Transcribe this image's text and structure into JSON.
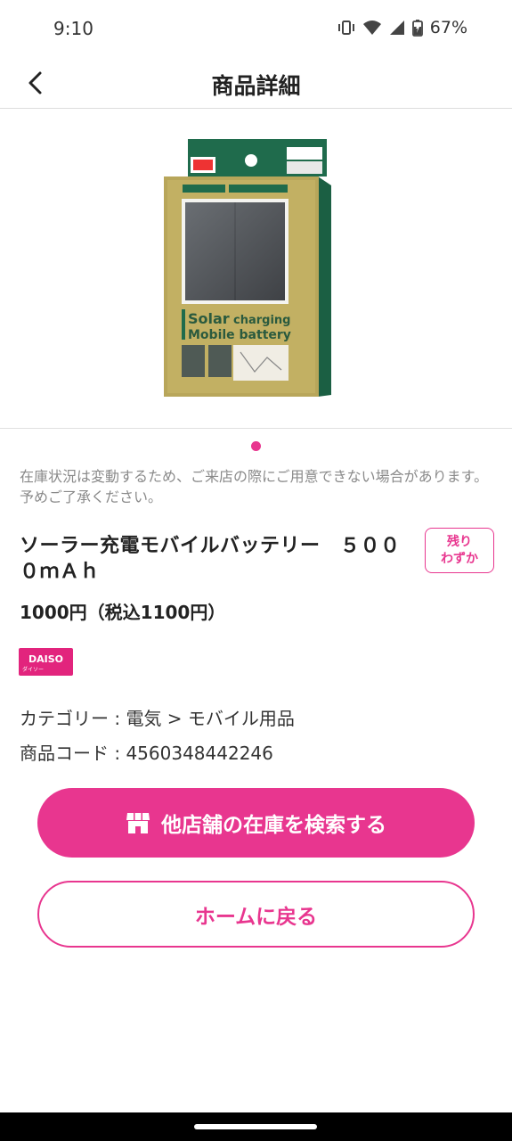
{
  "status_bar": {
    "time": "9:10",
    "battery_percent": "67%",
    "icons": [
      "vibrate-icon",
      "wifi-icon",
      "cell-signal-icon",
      "battery-charging-icon"
    ]
  },
  "app_bar": {
    "title": "商品詳細",
    "back_icon": "chevron-left-icon"
  },
  "product": {
    "image_label": "Solar charging Mobile battery",
    "image_count": 1,
    "image_current": 1,
    "stock_notice": "在庫状況は変動するため、ご来店の際にご用意できない場合があります。予めご了承ください。",
    "name": "ソーラー充電モバイルバッテリー　５０００ｍＡｈ",
    "stock_badge_line1": "残り",
    "stock_badge_line2": "わずか",
    "price": "1000円（税込1100円）",
    "brand_logo_text": "DAISO",
    "brand_logo_sub": "ダイソー",
    "category": "カテゴリー : 電気 > モバイル用品",
    "code": "商品コード : 4560348442246"
  },
  "buttons": {
    "search_other_stores": "他店舗の在庫を検索する",
    "search_icon": "store-icon",
    "back_home": "ホームに戻る"
  },
  "colors": {
    "accent": "#e8368f",
    "brand": "#e2247d",
    "notice_text": "#8a8a8a"
  }
}
